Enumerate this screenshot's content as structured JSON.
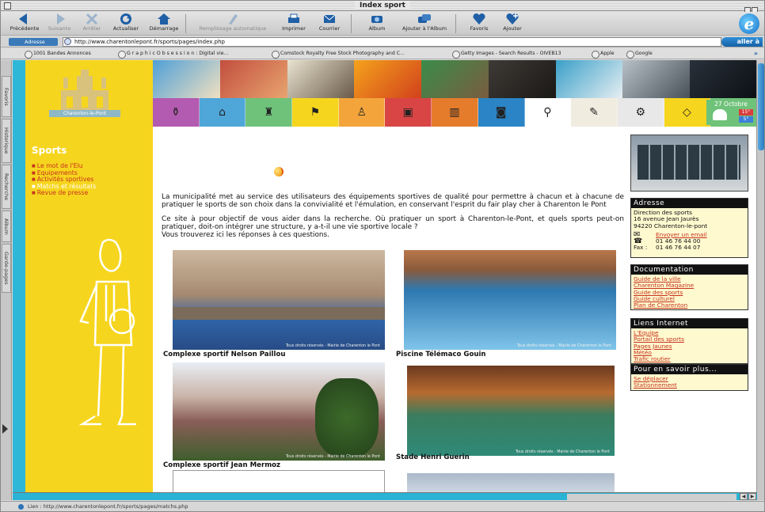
{
  "window": {
    "title": "Index sport"
  },
  "toolbar": {
    "buttons": [
      {
        "label": "Précédente",
        "icon": "back-arrow-icon",
        "dim": false
      },
      {
        "label": "Suivante",
        "icon": "forward-arrow-icon",
        "dim": true
      },
      {
        "label": "Arrêter",
        "icon": "stop-icon",
        "dim": true
      },
      {
        "label": "Actualiser",
        "icon": "refresh-icon",
        "dim": false
      },
      {
        "label": "Démarrage",
        "icon": "home-icon",
        "dim": false
      },
      {
        "label": "Remplissage automatique",
        "icon": "autofill-icon",
        "dim": true
      },
      {
        "label": "Imprimer",
        "icon": "print-icon",
        "dim": false
      },
      {
        "label": "Courrier",
        "icon": "mail-icon",
        "dim": false
      },
      {
        "label": "Album",
        "icon": "album-icon",
        "dim": false
      },
      {
        "label": "Ajouter à l'Album",
        "icon": "add-album-icon",
        "dim": false
      },
      {
        "label": "Favoris",
        "icon": "heart-icon",
        "dim": false
      },
      {
        "label": "Ajouter",
        "icon": "add-favorite-icon",
        "dim": false
      }
    ]
  },
  "address": {
    "label": "Adresse",
    "url": "http://www.charentonlepont.fr/sports/pages/index.php",
    "go": "aller à"
  },
  "favorites": [
    "1001 Bandes Annonces",
    "G r a p h i c O b s e s s i o n : Digital vie...",
    "Comstock Royalty Free Stock Photography and C...",
    "Getty Images - Search Results - OIVEB13",
    "Apple",
    "Google"
  ],
  "favorites_more": "»",
  "sidetabs": [
    "Favoris",
    "Historique",
    "Recherche",
    "Album",
    "Garde-pages"
  ],
  "site": {
    "logo_label": "Charenton-le-Pont",
    "section_title": "Sports",
    "menu": [
      {
        "label": "Le mot de l'Elu",
        "highlight": false
      },
      {
        "label": "Equipements",
        "highlight": false
      },
      {
        "label": "Activités sportives",
        "highlight": false
      },
      {
        "label": "Matchs et résultats",
        "highlight": true
      },
      {
        "label": "Revue de presse",
        "highlight": false
      }
    ],
    "date": "27 Octobre",
    "temp_high": "15°",
    "temp_low": "5°",
    "intro_p1": "La municipalité met au service des utilisateurs des équipements sportives de qualité pour permettre à chacun et à chacune de pratiquer le sports de son choix dans la convivialité et l'émulation, en conservant l'esprit du fair play cher à Charenton le Pont",
    "intro_p2": "Ce site à pour objectif de vous aider dans la recherche. Où pratiquer un sport à Charenton-le-Pont, et quels sports peut-on pratiquer, doit-on intégrer une structure, y a-t-il une vie sportive locale ?",
    "intro_p3": "Vous trouverez ici les réponses à ces questions.",
    "photo_credit": "Tous droits réservés - Mairie de Charenton le Pont",
    "facilities": [
      "Complexe sportif Nelson Paillou",
      "Piscine Télémaco Gouin",
      "Complexe sportif Jean Mermoz",
      "Stade Henri Guerin"
    ],
    "address_box": {
      "title": "Adresse",
      "lines": [
        "Direction des sports",
        "16 avenue Jean Jaurès",
        "94220 Charenton-le-pont"
      ],
      "email_link": "Envoyer un email",
      "phone": "01 46 76 44 00",
      "fax_label": "Fax :",
      "fax": "01 46 76 44 07"
    },
    "documentation": {
      "title": "Documentation",
      "links": [
        "Guide de la ville",
        "Charenton Magazine",
        "Guide des sports",
        "Guide culturel",
        "Plan de Charenton"
      ]
    },
    "liens": {
      "title": "Liens Internet",
      "links": [
        "L'Equipe",
        "Portail des sports",
        "Pages Jaunes",
        "Météo",
        "Trafic routier"
      ]
    },
    "savoir": {
      "title": "Pour en savoir plus...",
      "links": [
        "Se déplacer",
        "Stationnement"
      ]
    }
  },
  "status": {
    "text": "Lien : http://www.charentonlepont.fr/sports/pages/matchs.php"
  },
  "colors": {
    "yellow": "#f6d51e",
    "cyan": "#2fb7d8",
    "red_link": "#c6321d",
    "brand_blue": "#1c5fa8"
  }
}
